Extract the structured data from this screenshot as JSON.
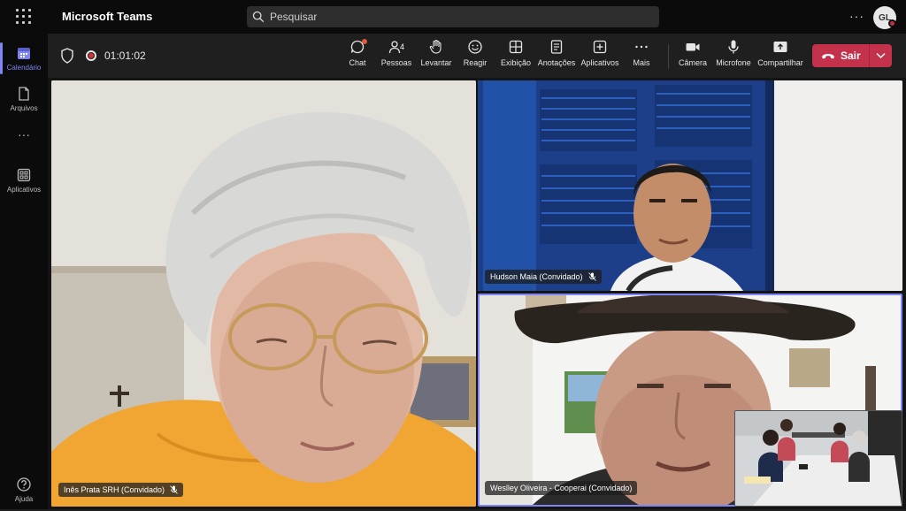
{
  "titlebar": {
    "app_title": "Microsoft Teams",
    "search_placeholder": "Pesquisar",
    "more": "···",
    "avatar_initials": "GL"
  },
  "rail": {
    "items": [
      {
        "label": "Calendário",
        "icon": "calendar-icon",
        "active": true
      },
      {
        "label": "Arquivos",
        "icon": "file-icon",
        "active": false
      },
      {
        "label": "Aplicativos",
        "icon": "apps-icon",
        "active": false
      },
      {
        "label": "Ajuda",
        "icon": "help-icon",
        "active": false
      }
    ],
    "more": "···"
  },
  "toolbar": {
    "timer": "01:01:02",
    "buttons": [
      {
        "label": "Chat",
        "icon": "chat-icon"
      },
      {
        "label": "Pessoas",
        "icon": "people-icon",
        "count": "4"
      },
      {
        "label": "Levantar",
        "icon": "raise-hand-icon"
      },
      {
        "label": "Reagir",
        "icon": "react-icon"
      },
      {
        "label": "Exibição",
        "icon": "view-icon"
      },
      {
        "label": "Anotações",
        "icon": "notes-icon"
      },
      {
        "label": "Aplicativos",
        "icon": "add-apps-icon"
      },
      {
        "label": "Mais",
        "icon": "more-icon"
      },
      {
        "label": "Câmera",
        "icon": "camera-icon"
      },
      {
        "label": "Microfone",
        "icon": "microphone-icon"
      },
      {
        "label": "Compartilhar",
        "icon": "share-icon"
      }
    ],
    "leave_label": "Sair"
  },
  "participants": [
    {
      "name": "Inês Prata SRH (Convidado)"
    },
    {
      "name": "Hudson Maia (Convidado)"
    },
    {
      "name": "Weslley Oliveira - Cooperai (Convidado)"
    }
  ],
  "colors": {
    "accent": "#7f85f5",
    "leave": "#c4314b",
    "recording": "#d13438"
  }
}
